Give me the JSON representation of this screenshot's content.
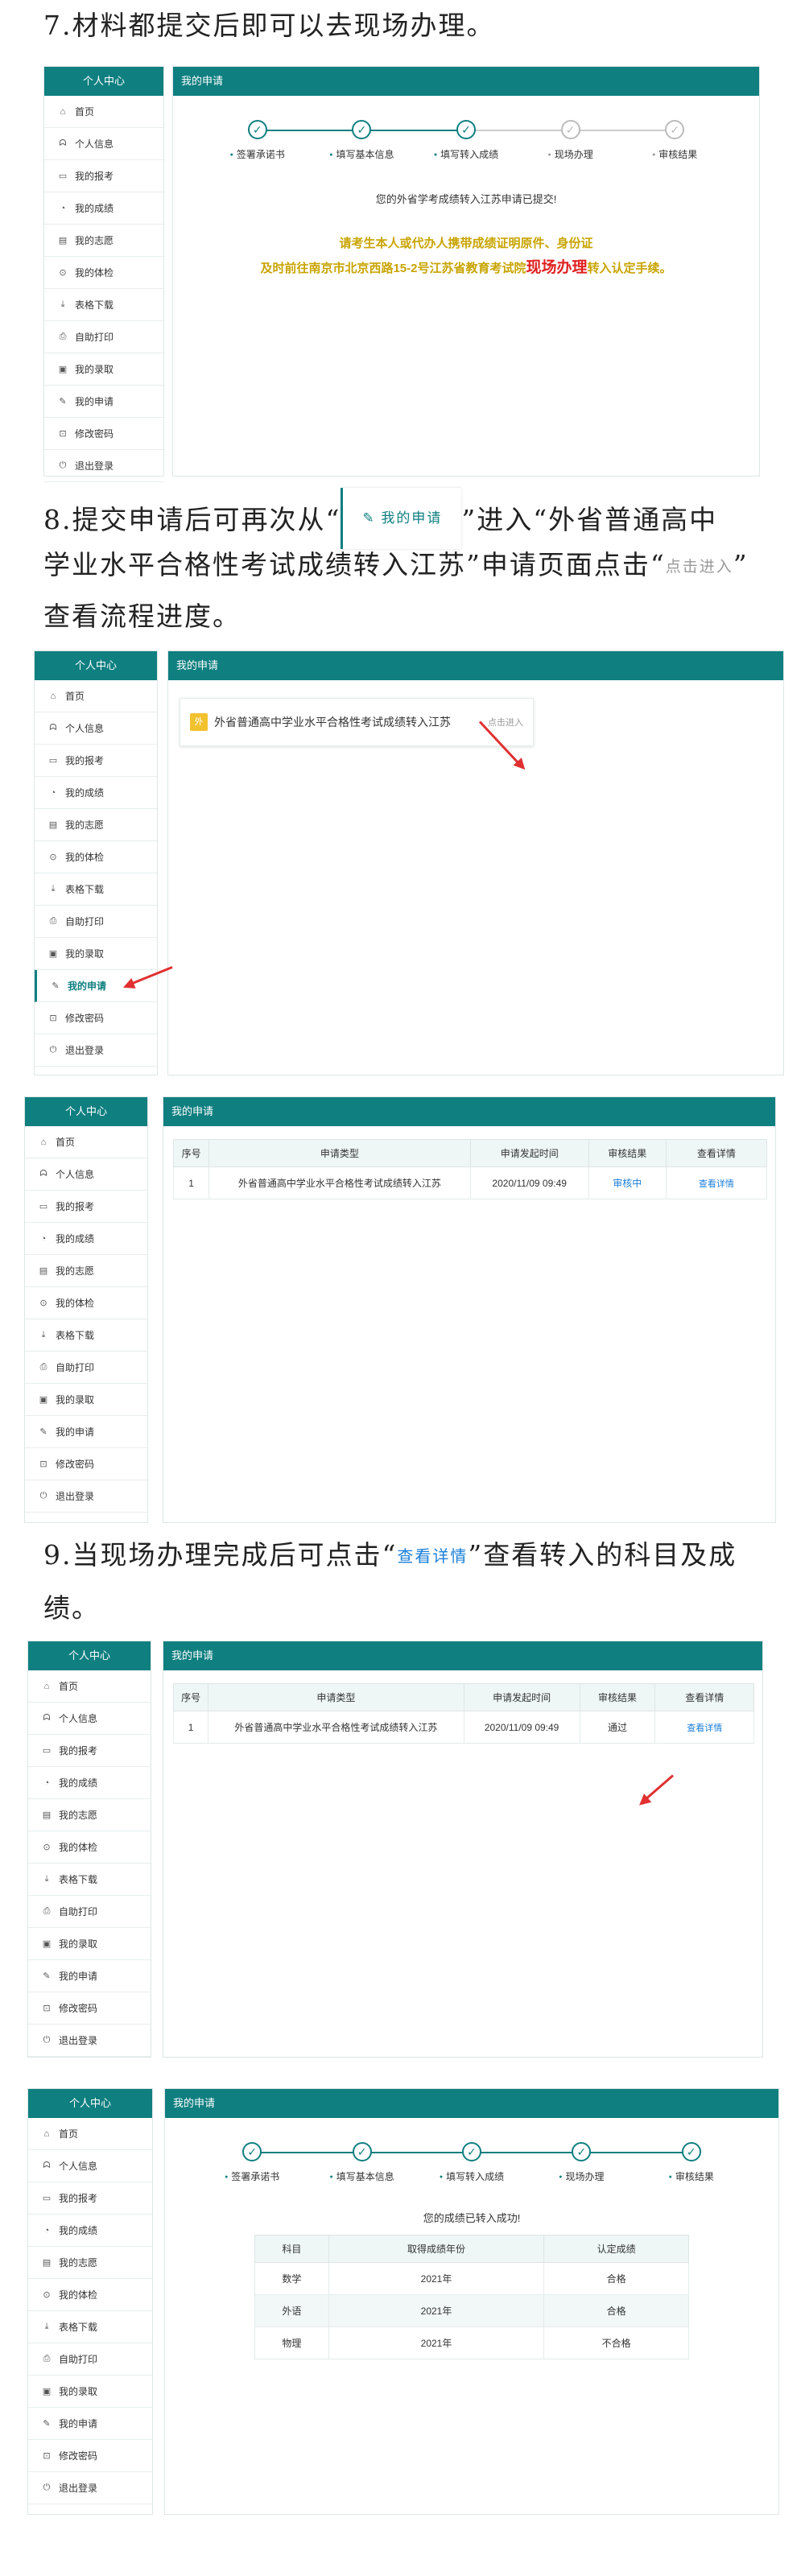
{
  "headings": {
    "h7": "7.材料都提交后即可以去现场办理。",
    "h8_a": "8.提交申请后可再次从“",
    "h8_btn": "我的申请",
    "h8_b": "”进入“外省普通高中",
    "h8_line2a": "学业水平合格性考试成绩转入江苏”申请页面点击“",
    "h8_enter": "点击进入",
    "h8_line2b": "”",
    "h8_line3": "查看流程进度。",
    "h9_a": "9.当现场办理完成后可点击“",
    "h9_link": "查看详情",
    "h9_b": "”查看转入的科目及成",
    "h9_line2": "绩。"
  },
  "sidebar": {
    "title": "个人中心",
    "items": [
      {
        "label": "首页",
        "icon": "home-icon",
        "glyph": "⌂"
      },
      {
        "label": "个人信息",
        "icon": "user-icon",
        "glyph": "ᗣ"
      },
      {
        "label": "我的报考",
        "icon": "card-icon",
        "glyph": "▭"
      },
      {
        "label": "我的成绩",
        "icon": "chart-icon",
        "glyph": "◔"
      },
      {
        "label": "我的志愿",
        "icon": "doc-icon",
        "glyph": "▤"
      },
      {
        "label": "我的体检",
        "icon": "check-icon",
        "glyph": "⊙"
      },
      {
        "label": "表格下载",
        "icon": "download-icon",
        "glyph": "⤓"
      },
      {
        "label": "自助打印",
        "icon": "print-icon",
        "glyph": "⎙"
      },
      {
        "label": "我的录取",
        "icon": "calendar-icon",
        "glyph": "▣"
      },
      {
        "label": "我的申请",
        "icon": "edit-icon",
        "glyph": "✎"
      },
      {
        "label": "修改密码",
        "icon": "lock-icon",
        "glyph": "⊡"
      },
      {
        "label": "退出登录",
        "icon": "power-icon",
        "glyph": "⏻"
      }
    ]
  },
  "main_title": "我的申请",
  "steps": {
    "labels": [
      "签署承诺书",
      "填写基本信息",
      "填写转入成绩",
      "现场办理",
      "审核结果"
    ],
    "check": "✓"
  },
  "shot1": {
    "msg": "您的外省学考成绩转入江苏申请已提交!",
    "warn_line1": "请考生本人或代办人携带成绩证明原件、身份证",
    "warn_line2a": "及时前往南京市北京西路15-2号江苏省教育考试院",
    "warn_big": "现场办理",
    "warn_line2b": "转入认定手续。"
  },
  "shot2": {
    "card_badge": "外",
    "card_title": "外省普通高中学业水平合格性考试成绩转入江苏",
    "card_enter": "点击进入"
  },
  "table": {
    "headers": [
      "序号",
      "申请类型",
      "申请发起时间",
      "审核结果",
      "查看详情"
    ],
    "row": {
      "no": "1",
      "type": "外省普通高中学业水平合格性考试成绩转入江苏",
      "time": "2020/11/09 09:49",
      "detail": "查看详情"
    },
    "status_pending": "审核中",
    "status_pass": "通过"
  },
  "shot5": {
    "msg": "您的成绩已转入成功!",
    "headers": [
      "科目",
      "取得成绩年份",
      "认定成绩"
    ],
    "rows": [
      {
        "subject": "数学",
        "year": "2021年",
        "result": "合格"
      },
      {
        "subject": "外语",
        "year": "2021年",
        "result": "合格"
      },
      {
        "subject": "物理",
        "year": "2021年",
        "result": "不合格"
      }
    ]
  },
  "colors": {
    "primary": "#0f7f80",
    "link": "#1a7ed8",
    "warn": "#c8a400",
    "alert": "#e02020"
  }
}
